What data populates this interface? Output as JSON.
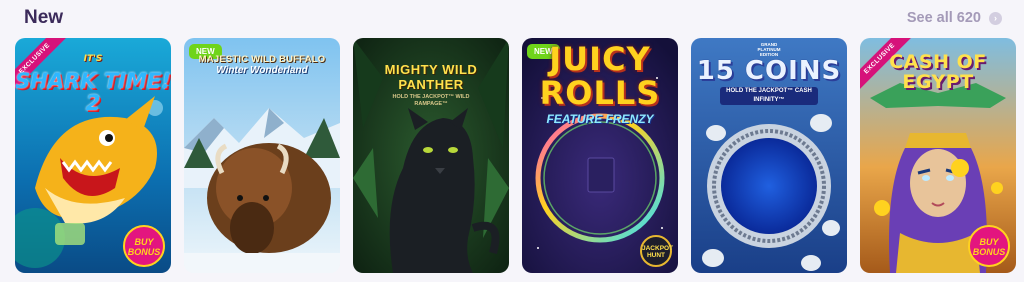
{
  "section": {
    "title": "New",
    "see_all_label": "See all 620",
    "see_all_icon": "chevron-right-icon"
  },
  "colors": {
    "title": "#3b2a5a",
    "see_all": "#a49ab8",
    "exclusive_ribbon": "#d6127a",
    "new_badge": "#6fd41a",
    "background": "#f6f5fa"
  },
  "games": [
    {
      "id": "its-shark-time-2",
      "title_small": "IT'S",
      "title": "SHARK TIME! 2",
      "ribbon": "EXCLUSIVE",
      "corner_badge": "BUY BONUS"
    },
    {
      "id": "majestic-wild-buffalo",
      "badge": "NEW",
      "title": "MAJESTIC WILD BUFFALO",
      "subtitle": "Winter Wonderland"
    },
    {
      "id": "mighty-wild-panther",
      "title": "MIGHTY WILD PANTHER",
      "subtitle": "HOLD THE JACKPOT™ WILD RAMPAGE™"
    },
    {
      "id": "juicy-rolls",
      "badge": "NEW",
      "title": "JUICY ROLLS",
      "subtitle": "FEATURE FRENZY",
      "corner_badge": "JACKPOT HUNT"
    },
    {
      "id": "15-coins",
      "title_top": "GRAND PLATINUM EDITION",
      "title": "15 COINS",
      "subtitle": "HOLD THE JACKPOT™ CASH INFINITY™"
    },
    {
      "id": "cash-of-egypt",
      "title": "CASH OF EGYPT",
      "ribbon": "EXCLUSIVE",
      "corner_badge": "BUY BONUS"
    }
  ]
}
